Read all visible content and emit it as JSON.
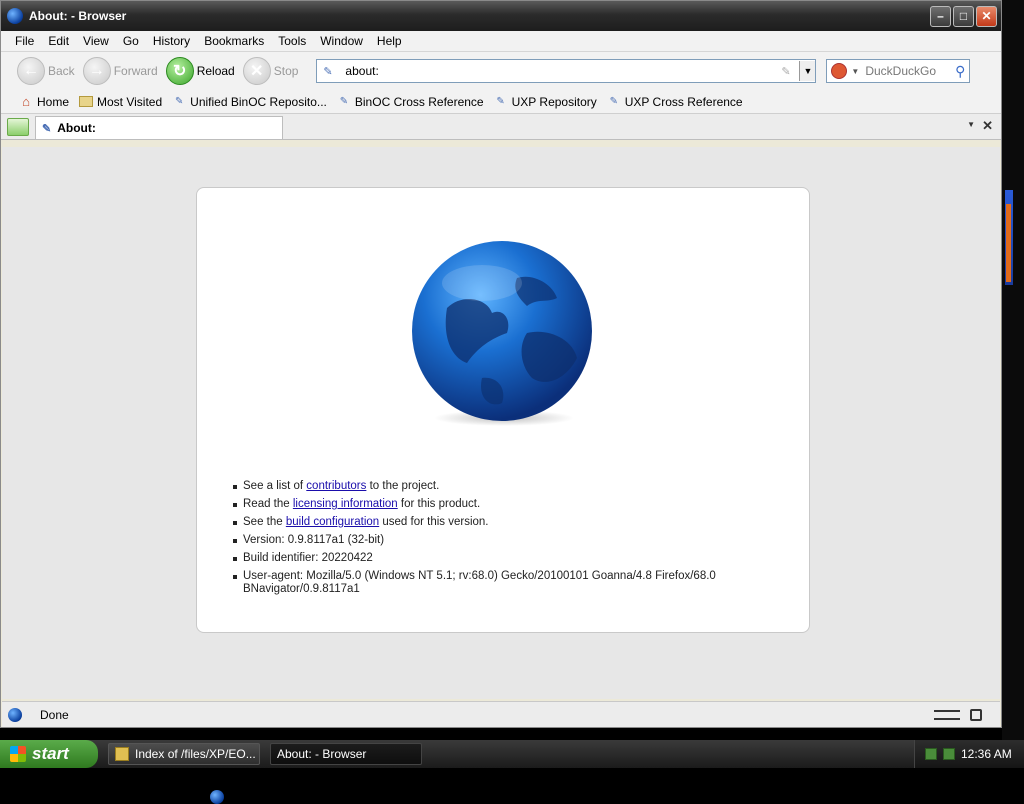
{
  "window": {
    "title": "About: - Browser"
  },
  "menubar": [
    "File",
    "Edit",
    "View",
    "Go",
    "History",
    "Bookmarks",
    "Tools",
    "Window",
    "Help"
  ],
  "navbar": {
    "back": "Back",
    "forward": "Forward",
    "reload": "Reload",
    "stop": "Stop",
    "url": "about:",
    "search_placeholder": "DuckDuckGo"
  },
  "bookmarks": [
    "Home",
    "Most Visited",
    "Unified BinOC Reposito...",
    "BinOC Cross Reference",
    "UXP Repository",
    "UXP Cross Reference"
  ],
  "tab": {
    "label": "About:"
  },
  "about": {
    "line1_pre": "See a list of ",
    "line1_link": "contributors",
    "line1_post": " to the project.",
    "line2_pre": "Read the ",
    "line2_link": "licensing information",
    "line2_post": " for this product.",
    "line3_pre": "See the ",
    "line3_link": "build configuration",
    "line3_post": " used for this version.",
    "version": "Version: 0.9.8117a1 (32-bit)",
    "build_id": "Build identifier: 20220422",
    "useragent_1": "User-agent: Mozilla/5.0 (Windows NT 5.1; rv:68.0) Gecko/20100101 Goanna/4.8 Firefox/68.0",
    "useragent_2": "BNavigator/0.9.8117a1"
  },
  "status": {
    "text": "Done"
  },
  "taskbar": {
    "start": "start",
    "items": [
      "Index of /files/XP/EO...",
      "About: - Browser"
    ],
    "clock": "12:36 AM"
  }
}
